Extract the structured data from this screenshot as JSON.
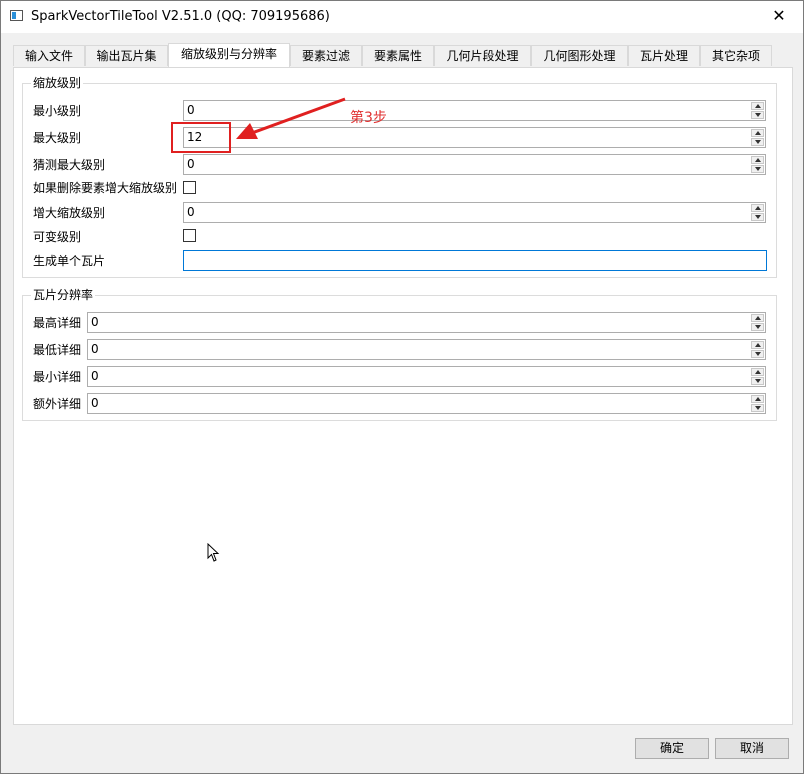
{
  "window": {
    "title": "SparkVectorTileTool V2.51.0  (QQ: 709195686)",
    "close_glyph": "✕"
  },
  "tabs": [
    {
      "label": "输入文件"
    },
    {
      "label": "输出瓦片集"
    },
    {
      "label": "缩放级别与分辨率"
    },
    {
      "label": "要素过滤"
    },
    {
      "label": "要素属性"
    },
    {
      "label": "几何片段处理"
    },
    {
      "label": "几何图形处理"
    },
    {
      "label": "瓦片处理"
    },
    {
      "label": "其它杂项"
    }
  ],
  "active_tab": "缩放级别与分辨率",
  "zoom_group": {
    "title": "缩放级别",
    "min_zoom_label": "最小级别",
    "min_zoom_value": "0",
    "max_zoom_label": "最大级别",
    "max_zoom_value": "12",
    "guess_max_label": "猜测最大级别",
    "guess_max_value": "0",
    "increase_if_drop_label": "如果删除要素增大缩放级别",
    "increase_if_drop_checked": false,
    "increase_zoom_label": "增大缩放级别",
    "increase_zoom_value": "0",
    "variable_label": "可变级别",
    "variable_checked": false,
    "single_tile_label": "生成单个瓦片",
    "single_tile_value": ""
  },
  "resolution_group": {
    "title": "瓦片分辨率",
    "highest_detail_label": "最高详细",
    "highest_detail_value": "0",
    "lowest_detail_label": "最低详细",
    "lowest_detail_value": "0",
    "min_detail_label": "最小详细",
    "min_detail_value": "0",
    "extra_detail_label": "额外详细",
    "extra_detail_value": "0"
  },
  "annotation": {
    "text": "第3步",
    "color": "#e03030"
  },
  "buttons": {
    "ok_label": "确定",
    "cancel_label": "取消"
  },
  "icons": {
    "app": "app-window-icon",
    "close": "close-icon",
    "cursor": "mouse-cursor-icon"
  }
}
